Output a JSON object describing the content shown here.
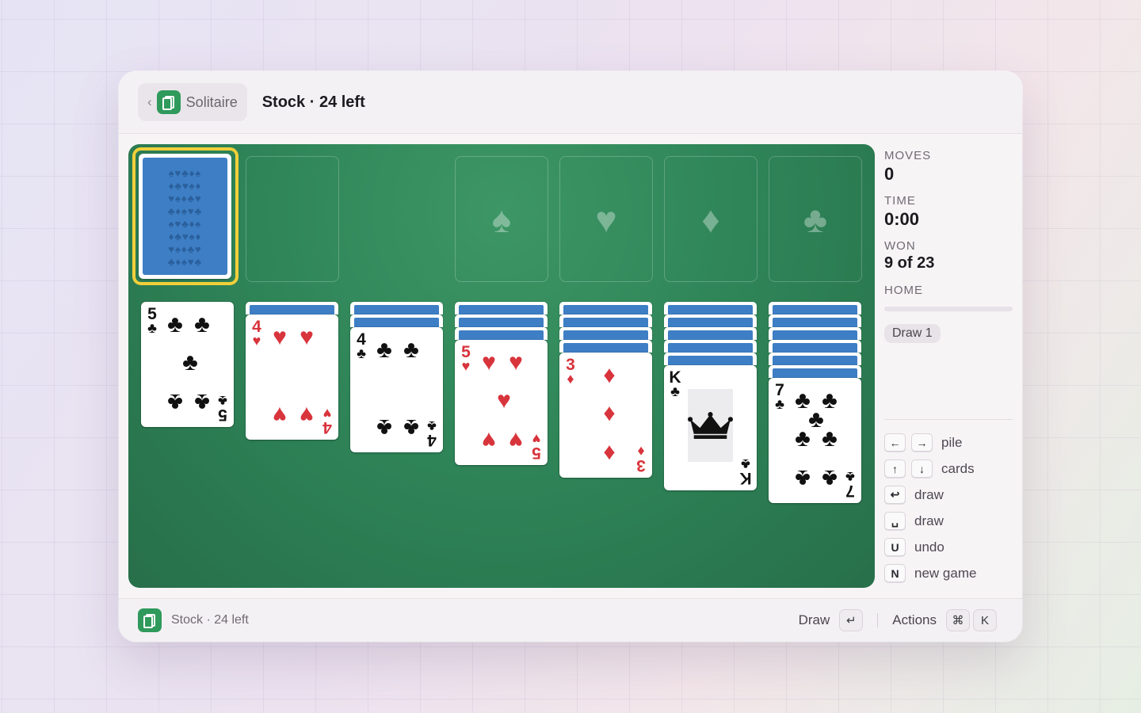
{
  "window": {
    "back_label": "Solitaire",
    "title": "Stock · 24 left"
  },
  "foundations": [
    {
      "suit": "spades",
      "symbol": "♠"
    },
    {
      "suit": "hearts",
      "symbol": "♥"
    },
    {
      "suit": "diamonds",
      "symbol": "♦"
    },
    {
      "suit": "clubs",
      "symbol": "♣"
    }
  ],
  "tableau": [
    {
      "face_down": 0,
      "top": {
        "rank": "5",
        "suit": "♣",
        "color": "black"
      }
    },
    {
      "face_down": 1,
      "top": {
        "rank": "4",
        "suit": "♥",
        "color": "red"
      }
    },
    {
      "face_down": 2,
      "top": {
        "rank": "4",
        "suit": "♣",
        "color": "black"
      }
    },
    {
      "face_down": 3,
      "top": {
        "rank": "5",
        "suit": "♥",
        "color": "red"
      }
    },
    {
      "face_down": 4,
      "top": {
        "rank": "3",
        "suit": "♦",
        "color": "red"
      }
    },
    {
      "face_down": 5,
      "top": {
        "rank": "K",
        "suit": "♣",
        "color": "black"
      }
    },
    {
      "face_down": 6,
      "top": {
        "rank": "7",
        "suit": "♣",
        "color": "black"
      }
    }
  ],
  "sidebar": {
    "moves_label": "MOVES",
    "moves": "0",
    "time_label": "TIME",
    "time": "0:00",
    "won_label": "WON",
    "won": "9 of 23",
    "home_label": "HOME",
    "home_progress": 0,
    "draw_mode": "Draw 1"
  },
  "shortcuts": [
    {
      "keys": [
        "←",
        "→"
      ],
      "label": "pile"
    },
    {
      "keys": [
        "↑",
        "↓"
      ],
      "label": "cards"
    },
    {
      "keys": [
        "↩"
      ],
      "label": "draw"
    },
    {
      "keys": [
        "␣"
      ],
      "label": "draw"
    },
    {
      "keys": [
        "U"
      ],
      "label": "undo"
    },
    {
      "keys": [
        "N"
      ],
      "label": "new game"
    }
  ],
  "footer": {
    "status": "Stock · 24 left",
    "primary_label": "Draw",
    "primary_key": "↵",
    "actions_label": "Actions",
    "actions_keys": [
      "⌘",
      "K"
    ]
  },
  "colors": {
    "felt": "#2f8558",
    "card_back": "#3d7ec4",
    "highlight": "#f2cf3a",
    "red_suit": "#d8343c",
    "app_icon": "#2f9a5c"
  }
}
